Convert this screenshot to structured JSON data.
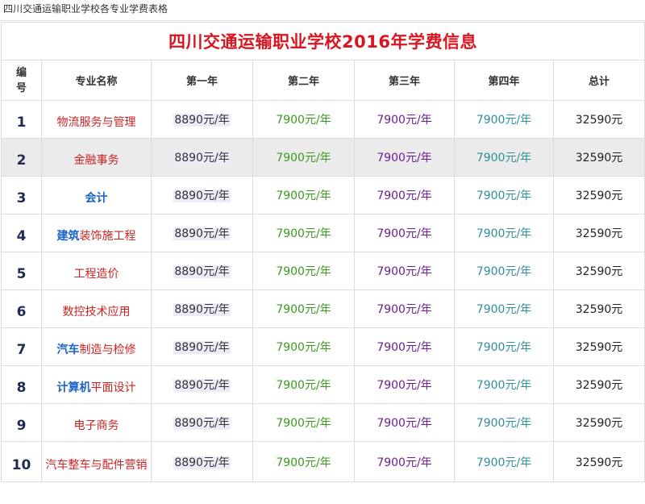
{
  "caption": "四川交通运输职业学校各专业学费表格",
  "table": {
    "title": "四川交通运输职业学校2016年学费信息",
    "headers": {
      "number_line1": "编",
      "number_line2": "号",
      "major": "专业名称",
      "year1": "第一年",
      "year2": "第二年",
      "year3": "第三年",
      "year4": "第四年",
      "total": "总计"
    },
    "rows": [
      {
        "no": "1",
        "major_hl": "",
        "major_rest": "物流服务与管理",
        "y1": "8890元/年",
        "y2": "7900元/年",
        "y3": "7900元/年",
        "y4": "7900元/年",
        "total": "32590元"
      },
      {
        "no": "2",
        "major_hl": "",
        "major_rest": "金融事务",
        "y1": "8890元/年",
        "y2": "7900元/年",
        "y3": "7900元/年",
        "y4": "7900元/年",
        "total": "32590元"
      },
      {
        "no": "3",
        "major_hl": "会计",
        "major_rest": "",
        "y1": "8890元/年",
        "y2": "7900元/年",
        "y3": "7900元/年",
        "y4": "7900元/年",
        "total": "32590元"
      },
      {
        "no": "4",
        "major_hl": "建筑",
        "major_rest": "装饰施工程",
        "y1": "8890元/年",
        "y2": "7900元/年",
        "y3": "7900元/年",
        "y4": "7900元/年",
        "total": "32590元"
      },
      {
        "no": "5",
        "major_hl": "",
        "major_rest": "工程造价",
        "y1": "8890元/年",
        "y2": "7900元/年",
        "y3": "7900元/年",
        "y4": "7900元/年",
        "total": "32590元"
      },
      {
        "no": "6",
        "major_hl": "",
        "major_rest": "数控技术应用",
        "y1": "8890元/年",
        "y2": "7900元/年",
        "y3": "7900元/年",
        "y4": "7900元/年",
        "total": "32590元"
      },
      {
        "no": "7",
        "major_hl": "汽车",
        "major_rest": "制造与检修",
        "y1": "8890元/年",
        "y2": "7900元/年",
        "y3": "7900元/年",
        "y4": "7900元/年",
        "total": "32590元"
      },
      {
        "no": "8",
        "major_hl": "计算机",
        "major_rest": "平面设计",
        "y1": "8890元/年",
        "y2": "7900元/年",
        "y3": "7900元/年",
        "y4": "7900元/年",
        "total": "32590元"
      },
      {
        "no": "9",
        "major_hl": "",
        "major_rest": "电子商务",
        "y1": "8890元/年",
        "y2": "7900元/年",
        "y3": "7900元/年",
        "y4": "7900元/年",
        "total": "32590元"
      },
      {
        "no": "10",
        "major_hl": "",
        "major_rest": "汽车整车与配件营销",
        "y1": "8890元/年",
        "y2": "7900元/年",
        "y3": "7900元/年",
        "y4": "7900元/年",
        "total": "32590元"
      }
    ]
  },
  "colors": {
    "title": "#d9151f",
    "major_text": "#cc2222",
    "major_highlight": "#1a63c9",
    "year2": "#3a9a1e",
    "year3": "#6a1f93",
    "year4": "#2f8f96",
    "alt_row_bg": "#ebebeb"
  }
}
